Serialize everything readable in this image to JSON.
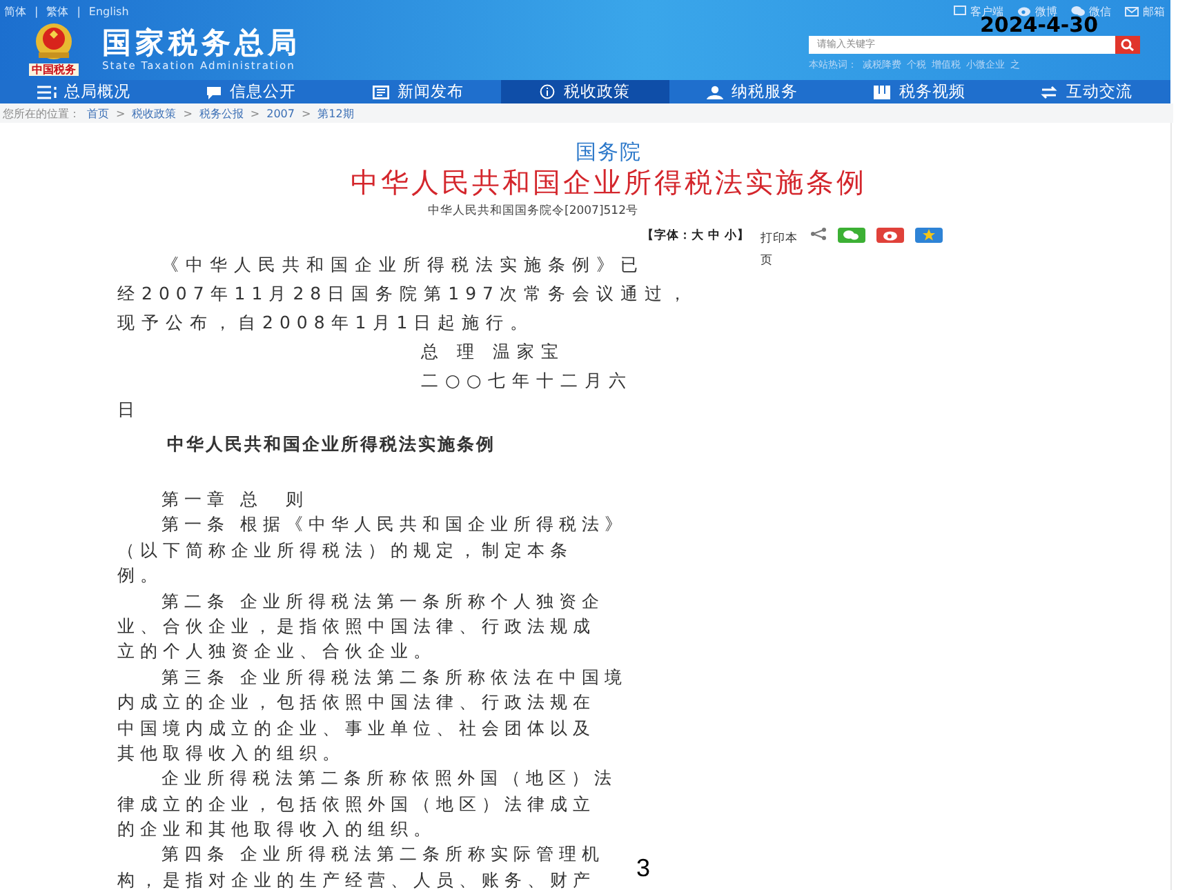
{
  "top_links": {
    "separator": "|",
    "items": [
      "简体",
      "繁体",
      "English"
    ]
  },
  "site": {
    "logo_text": "中国税务",
    "title": "国家税务总局",
    "subtitle": "State Taxation Administration"
  },
  "utility_links": [
    "客户端",
    "微博",
    "微信",
    "邮箱"
  ],
  "search": {
    "placeholder": "请输入关键字"
  },
  "hot_words": {
    "label": "本站热词：",
    "items": [
      "减税降费",
      "个税",
      "增值税",
      "小微企业",
      "之"
    ]
  },
  "nav": [
    {
      "label": "总局概况",
      "selected": false
    },
    {
      "label": "信息公开",
      "selected": false
    },
    {
      "label": "新闻发布",
      "selected": false
    },
    {
      "label": "税收政策",
      "selected": true
    },
    {
      "label": "纳税服务",
      "selected": false
    },
    {
      "label": "税务视频",
      "selected": false
    },
    {
      "label": "互动交流",
      "selected": false
    }
  ],
  "breadcrumb": {
    "label": "您所在的位置：",
    "separator": ">",
    "items": [
      "首页",
      "税收政策",
      "税务公报",
      "2007",
      "第12期"
    ]
  },
  "article": {
    "issuer": "国务院",
    "title": "中华人民共和国企业所得税法实施条例",
    "doc_number": "中华人民共和国国务院令[2007]512号",
    "font_control": "【字体：大 中 小】",
    "print": "打印本页",
    "preamble": [
      {
        "kind": "indent",
        "text": "《中华人民共和国企业所得税法实施条例》已"
      },
      {
        "kind": "plain",
        "text": "经2007年11月28日国务院第197次常务会议通过，"
      },
      {
        "kind": "plain",
        "text": "现予公布，自2008年1月1日起施行。"
      },
      {
        "kind": "signature",
        "text": "总 理 温家宝"
      },
      {
        "kind": "signature",
        "text": "二○○七年十二月六"
      },
      {
        "kind": "plain",
        "text": "日"
      }
    ],
    "heading": "中华人民共和国企业所得税法实施条例",
    "lines": [
      {
        "kind": "indent",
        "text": "第一章 总　则"
      },
      {
        "kind": "indent",
        "text": "第一条 根据《中华人民共和国企业所得税法》"
      },
      {
        "kind": "plain",
        "text": "（以下简称企业所得税法）的规定，制定本条"
      },
      {
        "kind": "plain",
        "text": "例。"
      },
      {
        "kind": "indent",
        "text": "第二条 企业所得税法第一条所称个人独资企"
      },
      {
        "kind": "plain",
        "text": "业、合伙企业，是指依照中国法律、行政法规成"
      },
      {
        "kind": "plain",
        "text": "立的个人独资企业、合伙企业。"
      },
      {
        "kind": "indent",
        "text": "第三条 企业所得税法第二条所称依法在中国境"
      },
      {
        "kind": "plain",
        "text": "内成立的企业，包括依照中国法律、行政法规在"
      },
      {
        "kind": "plain",
        "text": "中国境内成立的企业、事业单位、社会团体以及"
      },
      {
        "kind": "plain",
        "text": "其他取得收入的组织。"
      },
      {
        "kind": "indent",
        "text": "企业所得税法第二条所称依照外国（地区）法"
      },
      {
        "kind": "plain",
        "text": "律成立的企业，包括依照外国（地区）法律成立"
      },
      {
        "kind": "plain",
        "text": "的企业和其他取得收入的组织。"
      },
      {
        "kind": "indent",
        "text": "第四条 企业所得税法第二条所称实际管理机"
      },
      {
        "kind": "plain",
        "text": "构，是指对企业的生产经营、人员、账务、财产"
      }
    ]
  },
  "slide": {
    "date": "2024-4-30",
    "page": "3"
  }
}
